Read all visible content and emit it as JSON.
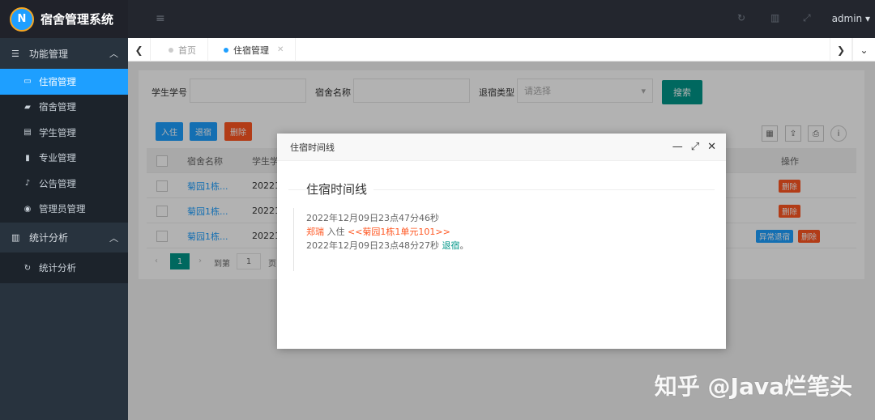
{
  "app": {
    "title": "宿舍管理系统",
    "logo_letter": "N"
  },
  "header": {
    "user": "admin ▾",
    "menu_icon": "list-icon",
    "icons": [
      "refresh-icon",
      "trash-icon",
      "fullscreen-icon"
    ]
  },
  "sidebar": {
    "groups": [
      {
        "label": "功能管理",
        "icon": "list-icon",
        "items": [
          {
            "label": "住宿管理",
            "icon": "window-icon",
            "active": true
          },
          {
            "label": "宿舍管理",
            "icon": "book-icon"
          },
          {
            "label": "学生管理",
            "icon": "card-icon"
          },
          {
            "label": "专业管理",
            "icon": "file-icon"
          },
          {
            "label": "公告管理",
            "icon": "bell-icon"
          },
          {
            "label": "管理员管理",
            "icon": "user-circle-icon"
          }
        ]
      },
      {
        "label": "统计分析",
        "icon": "bar-chart-icon",
        "items": [
          {
            "label": "统计分析",
            "icon": "refresh-icon"
          }
        ]
      }
    ]
  },
  "tabs": [
    {
      "label": "首页",
      "active": false
    },
    {
      "label": "住宿管理",
      "active": true
    }
  ],
  "filters": {
    "student_no_label": "学生学号",
    "dorm_name_label": "宿舍名称",
    "checkout_type_label": "退宿类型",
    "checkout_type_placeholder": "请选择",
    "search_label": "搜索"
  },
  "toolbar": {
    "checkin": "入住",
    "checkout": "退宿",
    "delete": "删除"
  },
  "table": {
    "headers": {
      "dorm_name": "宿舍名称",
      "student_no": "学生学",
      "action": "操作"
    },
    "rows": [
      {
        "dorm_name": "菊园1栋...",
        "student_no": "20221",
        "actions": [
          "删除"
        ]
      },
      {
        "dorm_name": "菊园1栋...",
        "student_no": "20221",
        "actions": [
          "删除"
        ]
      },
      {
        "dorm_name": "菊园1栋...",
        "student_no": "20221",
        "actions": [
          "异常退宿",
          "删除"
        ]
      }
    ]
  },
  "pager": {
    "current": "1",
    "goto_label": "到第",
    "page_input": "1",
    "page_suffix": "页"
  },
  "modal": {
    "title": "住宿时间线",
    "heading": "住宿时间线",
    "entry1_time": "2022年12月09日23点47分46秒",
    "entry1_name": "郑瑞",
    "entry1_action": " 入住 ",
    "entry1_room": "<<菊园1栋1单元101>>",
    "entry2_time": "2022年12月09日23点48分27秒 ",
    "entry2_status": "退宿",
    "entry2_suffix": "。"
  },
  "watermark": "知乎 @Java烂笔头",
  "colors": {
    "primary": "#1e9fff",
    "danger": "#ff5722",
    "success": "#009688",
    "sidebar": "#28333e"
  }
}
